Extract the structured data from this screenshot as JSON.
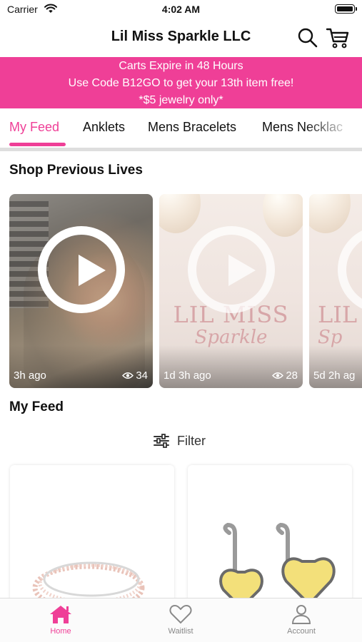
{
  "status_bar": {
    "carrier": "Carrier",
    "time": "4:02 AM"
  },
  "header": {
    "title": "Lil Miss Sparkle LLC"
  },
  "promo": {
    "line1": "Carts Expire in 48 Hours",
    "line2": "Use Code B12GO to get your 13th item free!",
    "line3": "*$5 jewelry only*"
  },
  "tabs": [
    {
      "label": "My Feed",
      "active": true
    },
    {
      "label": "Anklets"
    },
    {
      "label": "Mens Bracelets"
    },
    {
      "label": "Mens Necklac"
    }
  ],
  "previous_lives": {
    "title": "Shop Previous Lives",
    "cards": [
      {
        "time": "3h ago",
        "views": "34"
      },
      {
        "time": "1d 3h ago",
        "views": "28",
        "logo_line1": "LIL MISS",
        "logo_line2": "Sparkle"
      },
      {
        "time": "5d 2h ag",
        "logo_line1": "LIL",
        "logo_line2": "Sp"
      }
    ]
  },
  "feed": {
    "title": "My Feed",
    "filter_label": "Filter"
  },
  "bottom_nav": [
    {
      "label": "Home",
      "icon": "home-icon",
      "active": true
    },
    {
      "label": "Waitlist",
      "icon": "heart-icon"
    },
    {
      "label": "Account",
      "icon": "person-icon"
    }
  ],
  "colors": {
    "accent": "#ef3f97",
    "promo_bg": "#ef3f97",
    "divider": "#dedede"
  }
}
